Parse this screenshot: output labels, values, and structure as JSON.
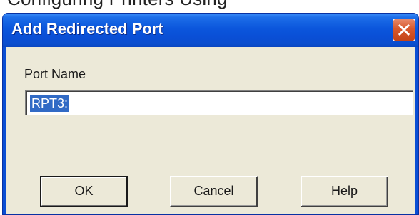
{
  "background": {
    "clipped_text": "Configuring Printers Using"
  },
  "dialog": {
    "title": "Add Redirected Port",
    "close_icon": "close-icon",
    "accent_color": "#0a4ed4",
    "client_color": "#ece9d8",
    "fields": {
      "port_name_label": "Port Name",
      "port_name_value": "RPT3:"
    },
    "buttons": {
      "ok_label": "OK",
      "cancel_label": "Cancel",
      "help_label": "Help"
    }
  }
}
